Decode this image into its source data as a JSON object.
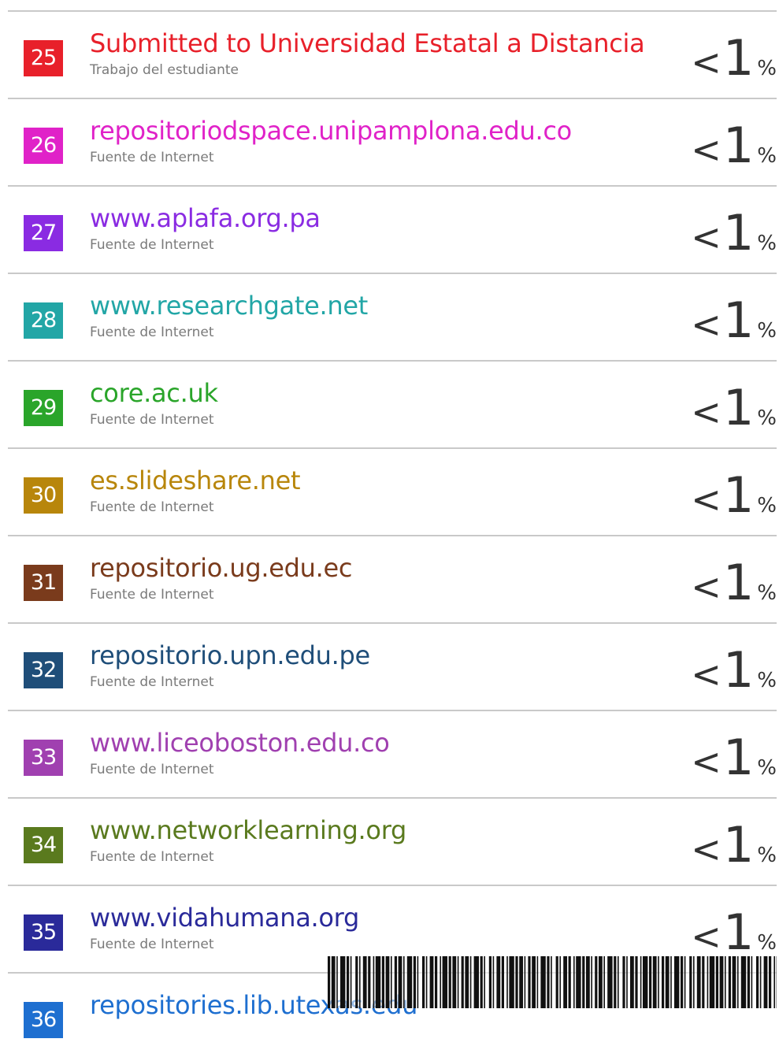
{
  "sources": [
    {
      "rank": "25",
      "title": "Submitted to Universidad Estatal a Distancia",
      "type": "Trabajo del estudiante",
      "pct_prefix": "<",
      "pct_value": "1",
      "pct_symbol": "%",
      "color": "#e8202a"
    },
    {
      "rank": "26",
      "title": "repositoriodspace.unipamplona.edu.co",
      "type": "Fuente de Internet",
      "pct_prefix": "<",
      "pct_value": "1",
      "pct_symbol": "%",
      "color": "#e022c8"
    },
    {
      "rank": "27",
      "title": "www.aplafa.org.pa",
      "type": "Fuente de Internet",
      "pct_prefix": "<",
      "pct_value": "1",
      "pct_symbol": "%",
      "color": "#8a2be2"
    },
    {
      "rank": "28",
      "title": "www.researchgate.net",
      "type": "Fuente de Internet",
      "pct_prefix": "<",
      "pct_value": "1",
      "pct_symbol": "%",
      "color": "#22a6a6"
    },
    {
      "rank": "29",
      "title": "core.ac.uk",
      "type": "Fuente de Internet",
      "pct_prefix": "<",
      "pct_value": "1",
      "pct_symbol": "%",
      "color": "#2aa52a"
    },
    {
      "rank": "30",
      "title": "es.slideshare.net",
      "type": "Fuente de Internet",
      "pct_prefix": "<",
      "pct_value": "1",
      "pct_symbol": "%",
      "color": "#b8860b"
    },
    {
      "rank": "31",
      "title": "repositorio.ug.edu.ec",
      "type": "Fuente de Internet",
      "pct_prefix": "<",
      "pct_value": "1",
      "pct_symbol": "%",
      "color": "#7a3b1c"
    },
    {
      "rank": "32",
      "title": "repositorio.upn.edu.pe",
      "type": "Fuente de Internet",
      "pct_prefix": "<",
      "pct_value": "1",
      "pct_symbol": "%",
      "color": "#1f4e79"
    },
    {
      "rank": "33",
      "title": "www.liceoboston.edu.co",
      "type": "Fuente de Internet",
      "pct_prefix": "<",
      "pct_value": "1",
      "pct_symbol": "%",
      "color": "#a040b0"
    },
    {
      "rank": "34",
      "title": "www.networklearning.org",
      "type": "Fuente de Internet",
      "pct_prefix": "<",
      "pct_value": "1",
      "pct_symbol": "%",
      "color": "#5a7a1e"
    },
    {
      "rank": "35",
      "title": "www.vidahumana.org",
      "type": "Fuente de Internet",
      "pct_prefix": "<",
      "pct_value": "1",
      "pct_symbol": "%",
      "color": "#2a2a9a"
    },
    {
      "rank": "36",
      "title": "repositories.lib.utexas.edu",
      "type": "",
      "pct_prefix": "",
      "pct_value": "",
      "pct_symbol": "",
      "color": "#1e6fd0"
    }
  ]
}
